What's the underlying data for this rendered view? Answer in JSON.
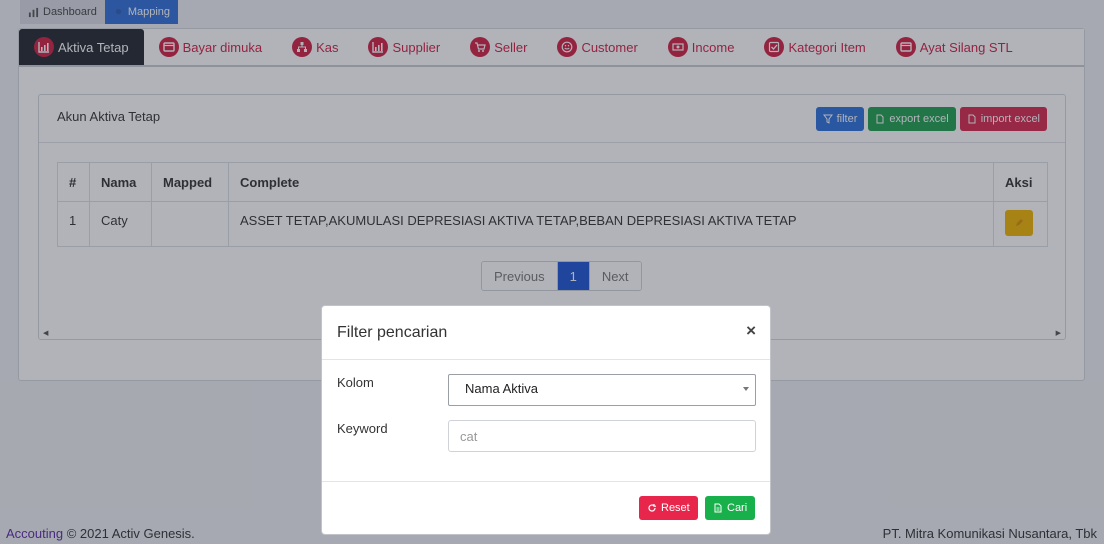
{
  "breadcrumb": {
    "dashboard": "Dashboard",
    "mapping": "Mapping"
  },
  "tabs": [
    {
      "label": "Aktiva Tetap",
      "icon": "chart-icon"
    },
    {
      "label": "Bayar dimuka",
      "icon": "window-icon"
    },
    {
      "label": "Kas",
      "icon": "sitemap-icon"
    },
    {
      "label": "Supplier",
      "icon": "chart-icon"
    },
    {
      "label": "Seller",
      "icon": "cart-icon"
    },
    {
      "label": "Customer",
      "icon": "smile-icon"
    },
    {
      "label": "Income",
      "icon": "money-icon"
    },
    {
      "label": "Kategori Item",
      "icon": "check-square-icon"
    },
    {
      "label": "Ayat Silang STL",
      "icon": "window-icon"
    }
  ],
  "panel": {
    "title": "Akun Aktiva Tetap",
    "filter_label": "filter",
    "export_label": "export excel",
    "import_label": "import excel"
  },
  "table": {
    "headers": [
      "#",
      "Nama",
      "Mapped",
      "Complete",
      "Aksi"
    ],
    "rows": [
      {
        "no": "1",
        "nama": "Caty",
        "mapped": "",
        "complete": "ASSET TETAP,AKUMULASI DEPRESIASI AKTIVA TETAP,BEBAN DEPRESIASI AKTIVA TETAP"
      }
    ]
  },
  "pagination": {
    "previous": "Previous",
    "current": "1",
    "next": "Next"
  },
  "footer": {
    "link": "Accouting",
    "copyright": " © 2021 Activ Genesis.",
    "company": "PT. Mitra Komunikasi Nusantara, Tbk"
  },
  "modal": {
    "title": "Filter pencarian",
    "close": "×",
    "kolom_label": "Kolom",
    "kolom_value": "Nama Aktiva",
    "keyword_label": "Keyword",
    "keyword_placeholder": "cat",
    "reset_label": "Reset",
    "cari_label": "Cari"
  },
  "colors": {
    "accent_red": "#d21f43",
    "primary_blue": "#2d6fda",
    "success_green": "#18b04a",
    "warning_yellow": "#f0b400"
  }
}
